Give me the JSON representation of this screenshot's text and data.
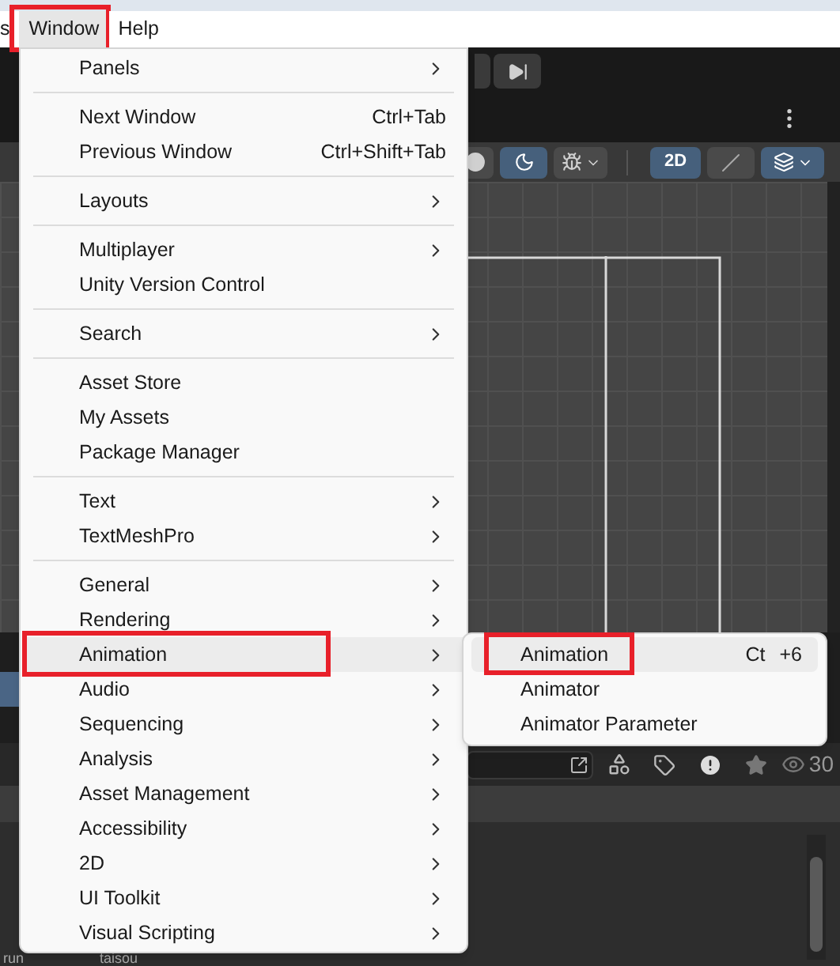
{
  "menu_bar": [
    {
      "label": "s",
      "selected": false,
      "annotated": false
    },
    {
      "label": "Window",
      "selected": true,
      "annotated": true
    },
    {
      "label": "Help",
      "selected": false,
      "annotated": false
    }
  ],
  "menu": {
    "groups": [
      [
        {
          "label": "Panels",
          "submenu": true,
          "selected": false,
          "annotated": false
        }
      ],
      [
        {
          "label": "Next Window",
          "shortcut": "Ctrl+Tab",
          "submenu": false,
          "selected": false,
          "annotated": false
        },
        {
          "label": "Previous Window",
          "shortcut": "Ctrl+Shift+Tab",
          "submenu": false,
          "selected": false,
          "annotated": false
        }
      ],
      [
        {
          "label": "Layouts",
          "submenu": true,
          "selected": false,
          "annotated": false
        }
      ],
      [
        {
          "label": "Multiplayer",
          "submenu": true,
          "selected": false,
          "annotated": false
        },
        {
          "label": "Unity Version Control",
          "submenu": false,
          "selected": false,
          "annotated": false
        }
      ],
      [
        {
          "label": "Search",
          "submenu": true,
          "selected": false,
          "annotated": false
        }
      ],
      [
        {
          "label": "Asset Store",
          "submenu": false,
          "selected": false,
          "annotated": false
        },
        {
          "label": "My Assets",
          "submenu": false,
          "selected": false,
          "annotated": false
        },
        {
          "label": "Package Manager",
          "submenu": false,
          "selected": false,
          "annotated": false
        }
      ],
      [
        {
          "label": "Text",
          "submenu": true,
          "selected": false,
          "annotated": false
        },
        {
          "label": "TextMeshPro",
          "submenu": true,
          "selected": false,
          "annotated": false
        }
      ],
      [
        {
          "label": "General",
          "submenu": true,
          "selected": false,
          "annotated": false
        },
        {
          "label": "Rendering",
          "submenu": true,
          "selected": false,
          "annotated": false
        },
        {
          "label": "Animation",
          "submenu": true,
          "selected": true,
          "annotated": true
        },
        {
          "label": "Audio",
          "submenu": true,
          "selected": false,
          "annotated": false
        },
        {
          "label": "Sequencing",
          "submenu": true,
          "selected": false,
          "annotated": false
        },
        {
          "label": "Analysis",
          "submenu": true,
          "selected": false,
          "annotated": false
        },
        {
          "label": "Asset Management",
          "submenu": true,
          "selected": false,
          "annotated": false
        },
        {
          "label": "Accessibility",
          "submenu": true,
          "selected": false,
          "annotated": false
        },
        {
          "label": "2D",
          "submenu": true,
          "selected": false,
          "annotated": false
        },
        {
          "label": "UI Toolkit",
          "submenu": true,
          "selected": false,
          "annotated": false
        },
        {
          "label": "Visual Scripting",
          "submenu": true,
          "selected": false,
          "annotated": false
        }
      ]
    ]
  },
  "submenu": [
    {
      "label": "Animation",
      "shortcut_parts": [
        "Ct",
        "+6"
      ],
      "selected": true,
      "annotated": true
    },
    {
      "label": "Animator",
      "selected": false,
      "annotated": false
    },
    {
      "label": "Animator Parameter",
      "selected": false,
      "annotated": false
    }
  ],
  "editor": {
    "mode_button": "2D",
    "visible_count": "30",
    "assets": [
      "run",
      "taisou"
    ]
  }
}
